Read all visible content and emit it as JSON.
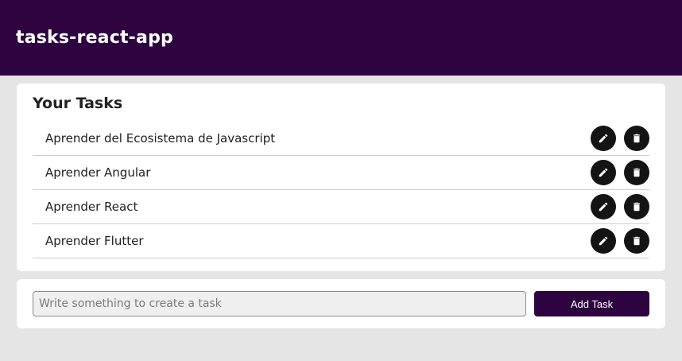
{
  "app": {
    "title": "tasks-react-app",
    "colors": {
      "primary": "#2d0340",
      "icon_button": "#141414",
      "background": "#e5e5e5"
    }
  },
  "tasks_panel": {
    "heading": "Your Tasks",
    "items": [
      {
        "text": "Aprender del Ecosistema de Javascript",
        "edit_icon": "pencil-icon",
        "delete_icon": "trash-icon"
      },
      {
        "text": "Aprender Angular",
        "edit_icon": "pencil-icon",
        "delete_icon": "trash-icon"
      },
      {
        "text": "Aprender React",
        "edit_icon": "pencil-icon",
        "delete_icon": "trash-icon"
      },
      {
        "text": "Aprender Flutter",
        "edit_icon": "pencil-icon",
        "delete_icon": "trash-icon"
      }
    ]
  },
  "add_form": {
    "input_value": "",
    "input_placeholder": "Write something to create a task",
    "button_label": "Add Task"
  }
}
